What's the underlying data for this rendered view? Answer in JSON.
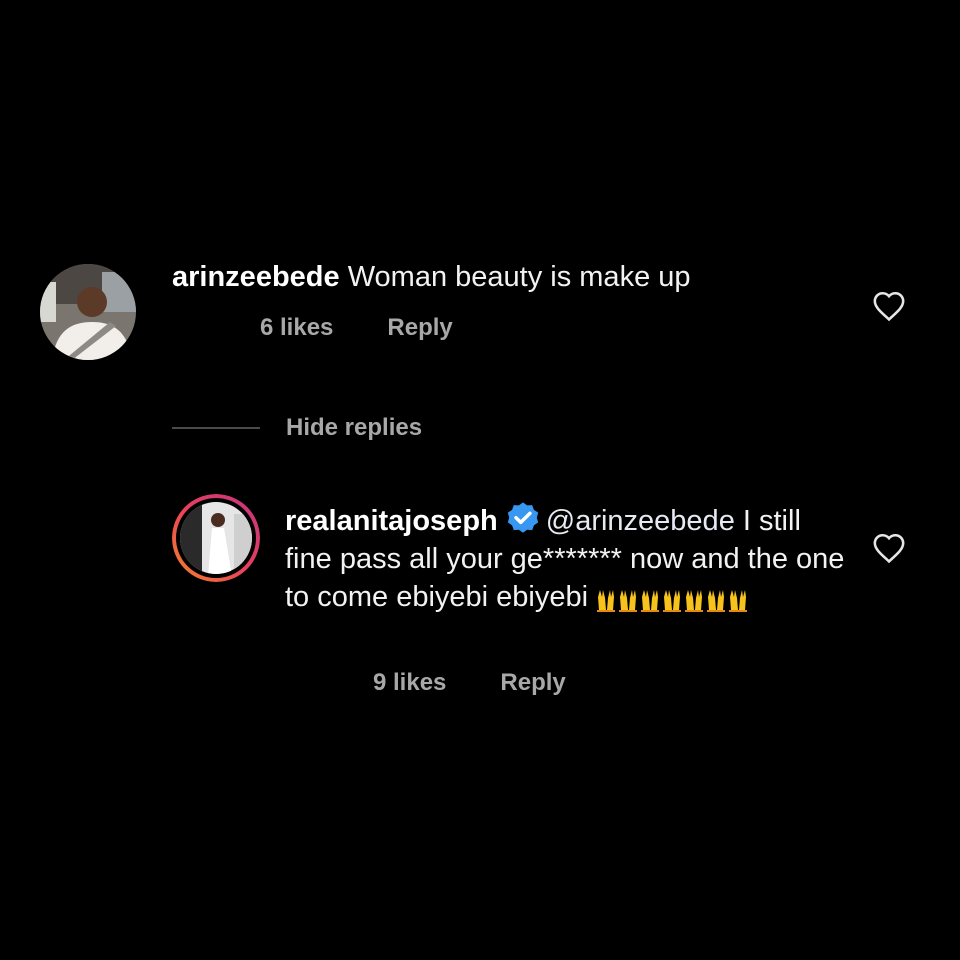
{
  "comments": [
    {
      "username": "arinzeebede",
      "text": "Woman beauty is make up",
      "likes": "6 likes",
      "reply": "Reply"
    }
  ],
  "hide_replies": "Hide replies",
  "reply": {
    "username": "realanitajoseph",
    "verified": true,
    "mention": "@arinzeebede",
    "text": " I still fine pass all your ge******* now and the one to come ebiyebi ebiyebi",
    "emoji": "🙌🙌🙌🙌🙌🙌🙌",
    "likes": "9 likes",
    "reply": "Reply"
  },
  "icons": {
    "like": "heart-outline-icon",
    "verified": "verified-badge-icon",
    "emoji": "raising-hands-emoji"
  },
  "colors": {
    "background": "#000000",
    "text": "#f2f2f2",
    "muted": "#a8a8a8",
    "verified": "#3897f0",
    "story_ring_start": "#f58529",
    "story_ring_end": "#dd2a7b"
  }
}
